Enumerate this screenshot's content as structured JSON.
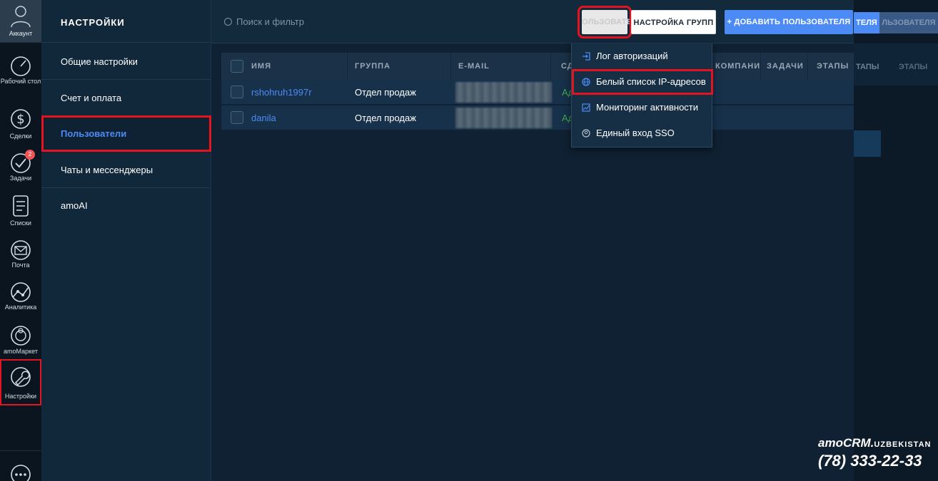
{
  "rail": {
    "account_label": "Аккаунт",
    "items": [
      {
        "label": "Рабочий стол",
        "icon": "dashboard-icon"
      },
      {
        "label": "Сделки",
        "icon": "dollar-icon"
      },
      {
        "label": "Задачи",
        "icon": "check-icon",
        "badge": "2"
      },
      {
        "label": "Списки",
        "icon": "list-icon"
      },
      {
        "label": "Почта",
        "icon": "mail-icon"
      },
      {
        "label": "Аналитика",
        "icon": "analytics-icon"
      },
      {
        "label": "amoМаркет",
        "icon": "market-icon"
      },
      {
        "label": "Настройки",
        "icon": "wrench-icon"
      }
    ]
  },
  "settings_nav": {
    "title": "НАСТРОЙКИ",
    "items": [
      "Общие настройки",
      "Счет и оплата",
      "Пользователи",
      "Чаты и мессенджеры",
      "amoAI"
    ],
    "active": "Пользователи"
  },
  "topbar": {
    "search_placeholder": "Поиск и фильтр",
    "btn_users": "ОЛЬЗОВАТЕЛИ",
    "btn_groups": "НАСТРОЙКА ГРУПП",
    "btn_add": "+ ДОБАВИТЬ ПОЛЬЗОВАТЕЛЯ"
  },
  "ghost": {
    "btn1": "ТЕЛЯ",
    "btn2": "ЛЬЗОВАТЕЛЯ",
    "col1": "ТАПЫ",
    "col2": "ЭТАПЫ"
  },
  "table": {
    "columns": [
      "ИМЯ",
      "ГРУППА",
      "E-MAIL",
      "СД",
      "КОМПАНИ",
      "ЗАДАЧИ",
      "ЭТАПЫ"
    ],
    "rows": [
      {
        "name": "rshohruh1997r",
        "group": "Отдел продаж",
        "status": "Ад"
      },
      {
        "name": "danila",
        "group": "Отдел продаж",
        "status": "Ад"
      }
    ]
  },
  "dropdown": {
    "items": [
      {
        "label": "Лог авторизаций",
        "icon": "login-icon"
      },
      {
        "label": "Белый список IP-адресов",
        "icon": "globe-icon"
      },
      {
        "label": "Мониторинг активности",
        "icon": "chart-icon"
      },
      {
        "label": "Единый вход SSO",
        "icon": "user-circle-icon"
      }
    ]
  },
  "brand": {
    "line1": "amoCRM.",
    "line1_suffix": "UZBEKISTAN",
    "phone": "(78) 333-22-33"
  },
  "colors": {
    "accent": "#4c8bf5",
    "highlight": "#e3141f",
    "status_green": "#3ea84a"
  }
}
